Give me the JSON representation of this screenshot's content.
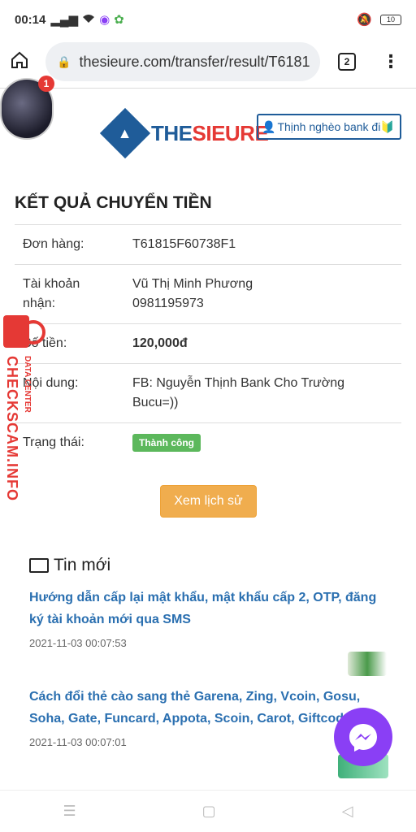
{
  "status_bar": {
    "time": "00:14",
    "battery": "10",
    "icons": [
      "signal-icon",
      "wifi-icon",
      "messenger-icon",
      "app-icon",
      "mute-icon",
      "battery-icon"
    ]
  },
  "browser": {
    "url": "thesieure.com/transfer/result/T6181",
    "tab_count": "2"
  },
  "profile": {
    "notification_count": "1"
  },
  "site": {
    "logo_text_a": "THE",
    "logo_text_b": "SIEURE",
    "user_button_label": "Thịnh nghèo bank đi🔰",
    "accent_color": "#1f5c99",
    "brand_red": "#e53935"
  },
  "result": {
    "title": "KẾT QUẢ CHUYỂN TIỀN",
    "rows": [
      {
        "label": "Đơn hàng:",
        "value": "T61815F60738F1"
      },
      {
        "label": "Tài khoản nhận:",
        "value": "Vũ Thị Minh Phương",
        "value2": "0981195973"
      },
      {
        "label": "Số tiền:",
        "value": "120,000đ"
      },
      {
        "label": "Nội dung:",
        "value": "FB: Nguyễn Thịnh Bank Cho Trường Bucu=))"
      },
      {
        "label": "Trạng thái:",
        "value": "Thành công"
      }
    ],
    "history_button": "Xem lịch sử"
  },
  "news": {
    "title": "Tin mới",
    "items": [
      {
        "title": "Hướng dẫn cấp lại mật khẩu, mật khẩu cấp 2, OTP, đăng ký tài khoản mới qua SMS",
        "date": "2021-11-03 00:07:53"
      },
      {
        "title": "Cách đổi thẻ cào sang thẻ Garena, Zing, Vcoin, Gosu, Soha, Gate, Funcard, Appota, Scoin, Carot, Giftcode",
        "date": "2021-11-03 00:07:01"
      }
    ]
  },
  "watermark": {
    "main": "CHECKSCAM.INFO",
    "sub": "DATA CENTER"
  },
  "nav": {
    "items": [
      "menu-icon",
      "home-icon",
      "back-icon"
    ]
  }
}
